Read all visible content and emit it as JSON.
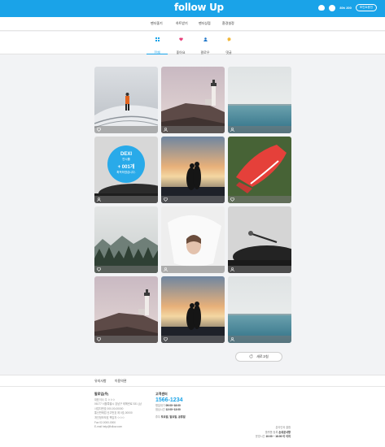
{
  "header": {
    "logo": "follow Up",
    "points": "80¢ 200",
    "charge_label": "포인트충전"
  },
  "menu": [
    {
      "label": "팬더좋기"
    },
    {
      "label": "하트받기"
    },
    {
      "label": "팬더상점"
    },
    {
      "label": "환경설정"
    }
  ],
  "tabs": [
    {
      "label": "전체",
      "icon": "grid-icon",
      "color": "#1aa3e8"
    },
    {
      "label": "좋아요",
      "icon": "heart-icon",
      "color": "#e8407a"
    },
    {
      "label": "팔로우",
      "icon": "user-icon",
      "color": "#1a73c8"
    },
    {
      "label": "댓글",
      "icon": "comment-icon",
      "color": "#f2b83a"
    }
  ],
  "cards": [
    {
      "scene": "snow",
      "type": "heart"
    },
    {
      "scene": "lighthouse",
      "type": "user"
    },
    {
      "scene": "sea",
      "type": "user"
    },
    {
      "scene": "vinyl-badge",
      "type": "user"
    },
    {
      "scene": "couple",
      "type": "heart"
    },
    {
      "scene": "shoe",
      "type": "heart"
    },
    {
      "scene": "forest",
      "type": "heart"
    },
    {
      "scene": "veil",
      "type": "user"
    },
    {
      "scene": "vinyl",
      "type": "user"
    },
    {
      "scene": "lighthouse",
      "type": "heart"
    },
    {
      "scene": "couple",
      "type": "heart"
    },
    {
      "scene": "sea",
      "type": "user"
    }
  ],
  "badge": {
    "line1": "DEXI",
    "line2": "연시를",
    "line3": "+ 001개",
    "line4": "획득하였습니다."
  },
  "refresh_label": "새로고침",
  "footer": {
    "links": [
      "유지사항",
      "이용약관"
    ],
    "company": {
      "name": "팔로업(주)",
      "lines": [
        "대표이사 주 ㅇㅇㅇ",
        "06177 서울특별시 강남구 테헤란로 531 (삼",
        "",
        "사업자번호 000-00-00000",
        "통신판매업 신고번호 제 0호-00000",
        "개인정보보호 책임자 ㅇㅇㅇ",
        "Fax 02-0000-0000",
        "E-mail help@follow.com"
      ]
    },
    "cs": {
      "title": "고객센터",
      "phone": "1566-1234",
      "hours_label": "평일대기",
      "hours_value": "09:00~18:00",
      "lunch_label": "점심시간",
      "lunch_value": "12:00~13:00",
      "closed_label": "휴무",
      "closed_value": "토요일, 일요일, 공휴일"
    },
    "right": {
      "line1": "온라인외 결합",
      "line2_label": "플랫폼 등록",
      "line2_value": "손쉬운사항",
      "line3_label": "운영시간",
      "line3_value": "10:00 ~ 18:00 이 이지"
    }
  },
  "colors": {
    "brand": "#1aa3e8",
    "background": "#f2f3f5"
  }
}
